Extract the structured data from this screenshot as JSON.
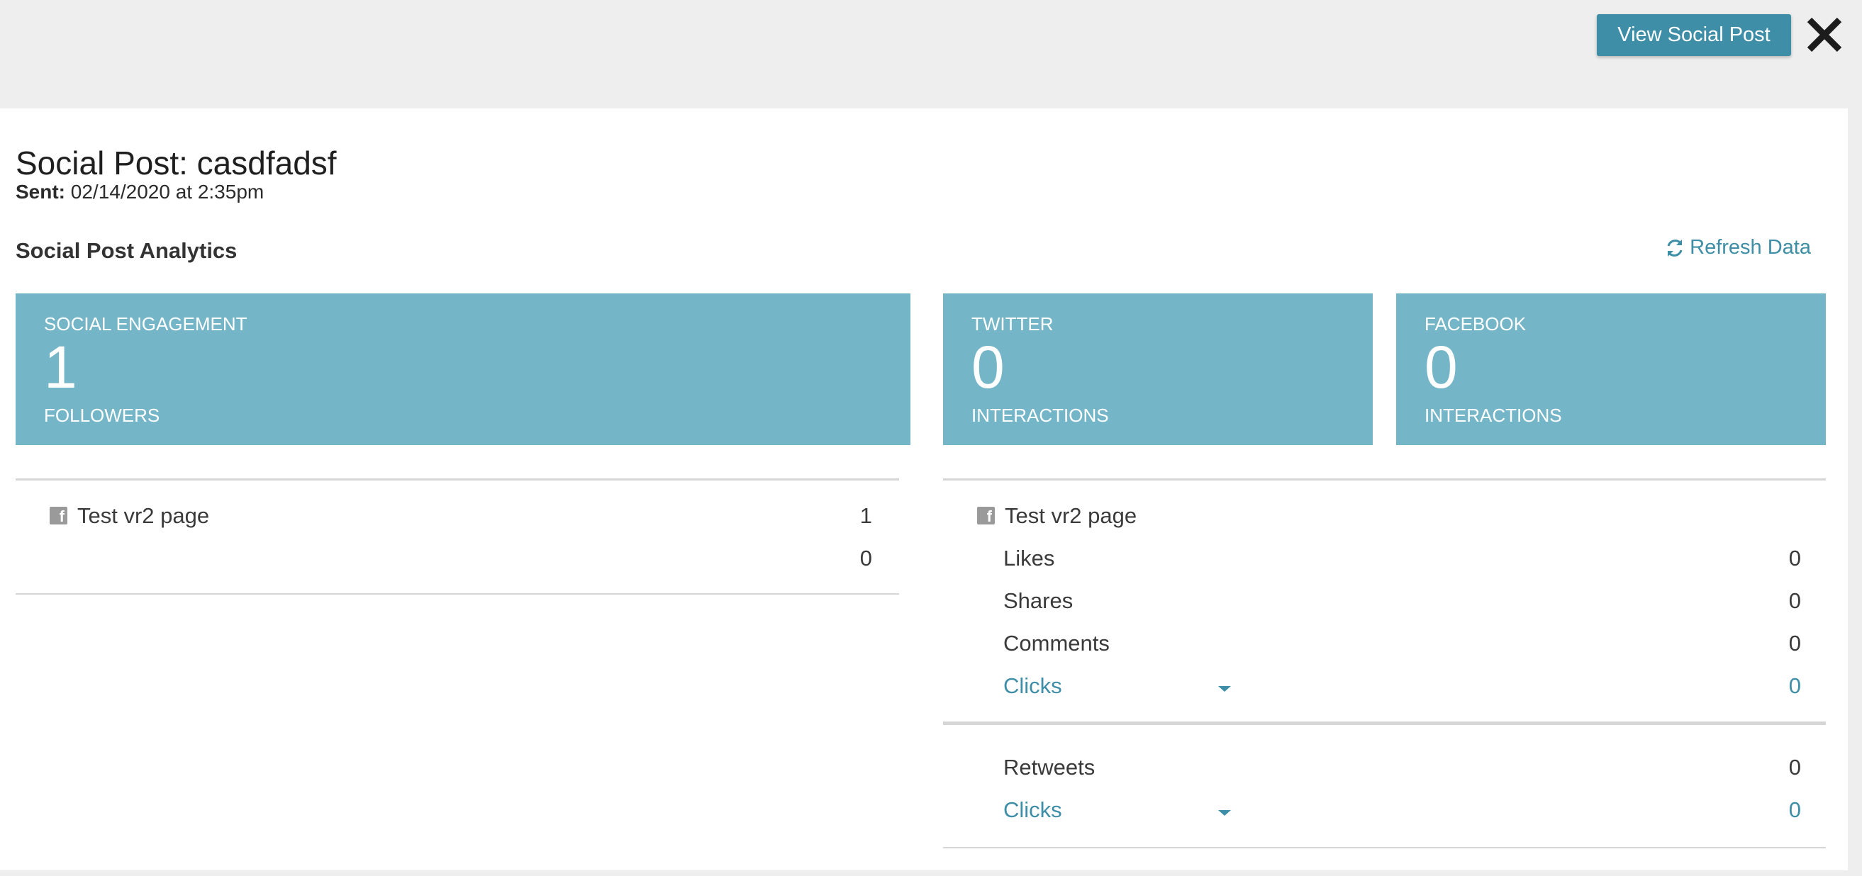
{
  "header": {
    "view_button_label": "View Social Post",
    "close_icon": "close-icon"
  },
  "post": {
    "title": "Social Post: casdfadsf",
    "sent_label": "Sent:",
    "sent_value": "02/14/2020 at 2:35pm"
  },
  "analytics": {
    "section_title": "Social Post Analytics",
    "refresh_label": "Refresh Data",
    "refresh_icon": "refresh-icon"
  },
  "cards": {
    "engagement": {
      "label": "SOCIAL ENGAGEMENT",
      "value": "1",
      "sub": "FOLLOWERS"
    },
    "twitter": {
      "label": "TWITTER",
      "value": "0",
      "sub": "INTERACTIONS"
    },
    "facebook": {
      "label": "FACEBOOK",
      "value": "0",
      "sub": "INTERACTIONS"
    }
  },
  "left_list": {
    "page_name": "Test vr2 page",
    "value_1": "1",
    "value_2": "0"
  },
  "facebook_list": {
    "page_name": "Test vr2 page",
    "rows": [
      {
        "label": "Likes",
        "value": "0"
      },
      {
        "label": "Shares",
        "value": "0"
      },
      {
        "label": "Comments",
        "value": "0"
      },
      {
        "label": "Clicks",
        "value": "0"
      }
    ]
  },
  "twitter_list": {
    "rows": [
      {
        "label": "Retweets",
        "value": "0"
      },
      {
        "label": "Clicks",
        "value": "0"
      }
    ]
  },
  "colors": {
    "accent": "#3d8ea6",
    "card_bg": "#74b6c7",
    "page_bg": "#eeeeee"
  }
}
